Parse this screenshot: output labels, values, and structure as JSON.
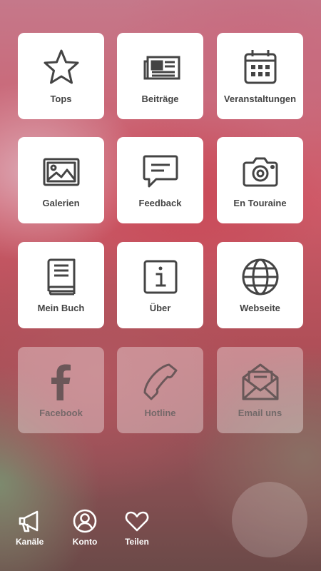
{
  "tiles": [
    {
      "label": "Tops",
      "icon": "star-icon"
    },
    {
      "label": "Beiträge",
      "icon": "newspaper-icon"
    },
    {
      "label": "Veranstaltungen",
      "icon": "calendar-icon"
    },
    {
      "label": "Galerien",
      "icon": "image-icon"
    },
    {
      "label": "Feedback",
      "icon": "chat-bubble-icon"
    },
    {
      "label": "En Touraine",
      "icon": "camera-icon"
    },
    {
      "label": "Mein Buch",
      "icon": "book-icon"
    },
    {
      "label": "Über",
      "icon": "info-icon"
    },
    {
      "label": "Webseite",
      "icon": "globe-icon"
    },
    {
      "label": "Facebook",
      "icon": "facebook-icon"
    },
    {
      "label": "Hotline",
      "icon": "phone-icon"
    },
    {
      "label": "Email uns",
      "icon": "envelope-icon"
    }
  ],
  "bottom_nav": [
    {
      "label": "Kanäle",
      "icon": "megaphone-icon"
    },
    {
      "label": "Konto",
      "icon": "user-circle-icon"
    },
    {
      "label": "Teilen",
      "icon": "heart-icon"
    }
  ],
  "colors": {
    "tile_bg": "#ffffff",
    "icon_color": "#444444",
    "nav_text": "#ffffff"
  }
}
